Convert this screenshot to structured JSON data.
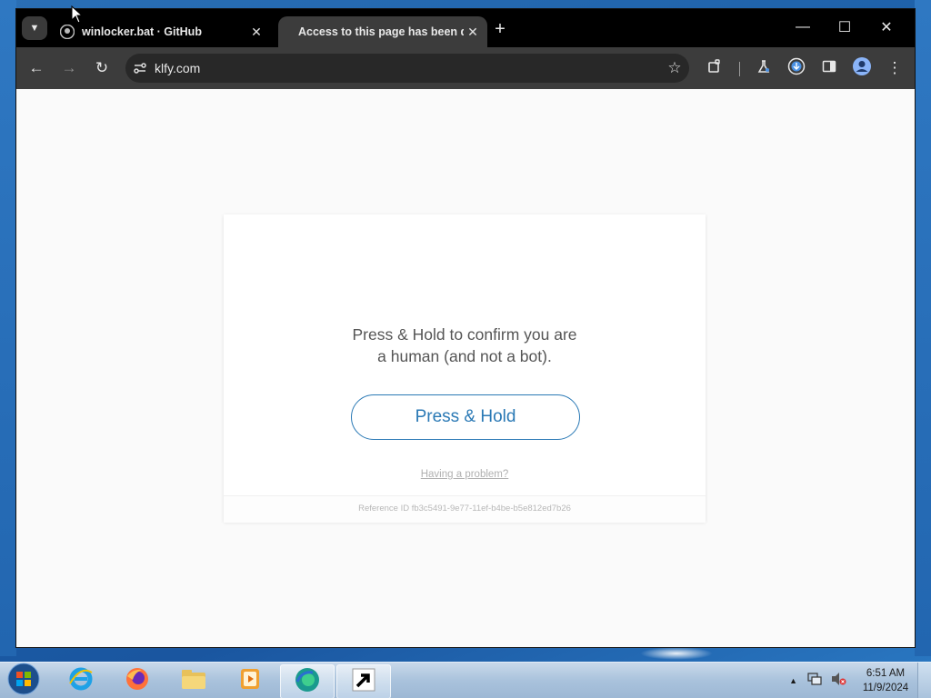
{
  "window": {
    "tabs": [
      {
        "title": "winlocker.bat · GitHub",
        "active": false,
        "favicon": "github-icon"
      },
      {
        "title": "Access to this page has been d",
        "active": true,
        "favicon": "none"
      }
    ],
    "controls": {
      "minimize": "—",
      "maximize": "☐",
      "close": "✕"
    }
  },
  "toolbar": {
    "url": "klfy.com"
  },
  "page": {
    "prompt_line1": "Press & Hold to confirm you are",
    "prompt_line2": "a human (and not a bot).",
    "button_label": "Press & Hold",
    "problem_link": "Having a problem?",
    "reference": "Reference ID fb3c5491-9e77-11ef-b4be-b5e812ed7b26"
  },
  "taskbar": {
    "time": "6:51 AM",
    "date": "11/9/2024",
    "apps": [
      "internet-explorer-icon",
      "firefox-icon",
      "file-explorer-icon",
      "media-player-icon",
      "edge-icon",
      "shortcut-arrow-icon"
    ]
  },
  "colors": {
    "accent": "#2a79b5",
    "browser_frame": "#000000",
    "toolbar": "#3c3c3c"
  }
}
